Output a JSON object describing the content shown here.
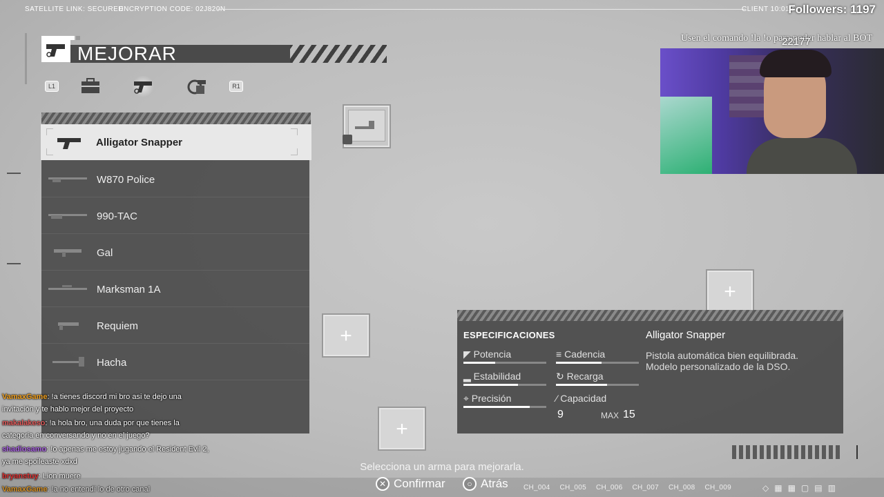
{
  "top_bar": {
    "satellite": "SATELLITE LINK: SECURED",
    "encryption": "ENCRYPTION CODE: 02J820N",
    "client": "CLIENT 10:01B"
  },
  "stream": {
    "followers": "Followers: 1197",
    "cam_caption": "Usen el comando !la !o para poder hablar al BOT",
    "cam_counter": "22177"
  },
  "header": {
    "title": "MEJORAR",
    "tabs": [
      {
        "label": "L1"
      },
      {
        "icon": "briefcase-icon"
      },
      {
        "icon": "handgun-icon"
      },
      {
        "icon": "grenade-launcher-icon"
      },
      {
        "label": "R1"
      }
    ]
  },
  "weapons": [
    {
      "name": "Alligator Snapper",
      "selected": true
    },
    {
      "name": "W870 Police",
      "selected": false
    },
    {
      "name": "990-TAC",
      "selected": false
    },
    {
      "name": "Gal",
      "selected": false
    },
    {
      "name": "Marksman 1A",
      "selected": false
    },
    {
      "name": "Requiem",
      "selected": false
    },
    {
      "name": "Hacha",
      "selected": false
    }
  ],
  "specs": {
    "heading": "ESPECIFICACIONES",
    "weapon_name": "Alligator Snapper",
    "description": "Pistola automática bien equilibrada. Modelo personalizado de la DSO.",
    "stats": [
      {
        "label": "Potencia",
        "icon": "power-icon",
        "level": 0.38
      },
      {
        "label": "Cadencia",
        "icon": "firerate-icon",
        "level": 0.55
      },
      {
        "label": "Estabilidad",
        "icon": "stability-icon",
        "level": 0.66
      },
      {
        "label": "Recarga",
        "icon": "reload-icon",
        "level": 0.62
      },
      {
        "label": "Precisión",
        "icon": "precision-icon",
        "level": 0.8
      }
    ],
    "capacity_label": "Capacidad",
    "capacity_value": "9",
    "capacity_max_label": "MAX",
    "capacity_max": "15"
  },
  "chat": [
    {
      "user": "VamaxGame",
      "color": "#f0a020",
      "text": ": !a tienes discord mi bro asi te dejo una invitación y te hablo mejor del proyecto"
    },
    {
      "user": "makalakeso",
      "color": "#e05a5a",
      "text": ": !a hola bro, una duda por que tienes la categoria en conversando y no en el juego?"
    },
    {
      "user": "shadiosamo",
      "color": "#a860e0",
      "text": ": !o apenas me estoy jugando el Resident Evil 2, ya me spoileaste xdxd"
    },
    {
      "user": "bryanstuy",
      "color": "#e03030",
      "text": ": Lion muere"
    },
    {
      "user": "VamaxGame",
      "color": "#f0a020",
      "text": ": !a no entendí lo de otro canal"
    }
  ],
  "footer": {
    "hint": "Selecciona un arma para mejorarla.",
    "confirm_label": "Confirmar",
    "back_label": "Atrás",
    "channels": [
      "CH_004",
      "CH_005",
      "CH_006",
      "CH_007",
      "CH_008",
      "CH_009"
    ]
  },
  "colors": {
    "background": "#bdbdbd",
    "panel": "#464646",
    "selected_row": "#e8e8e8"
  }
}
